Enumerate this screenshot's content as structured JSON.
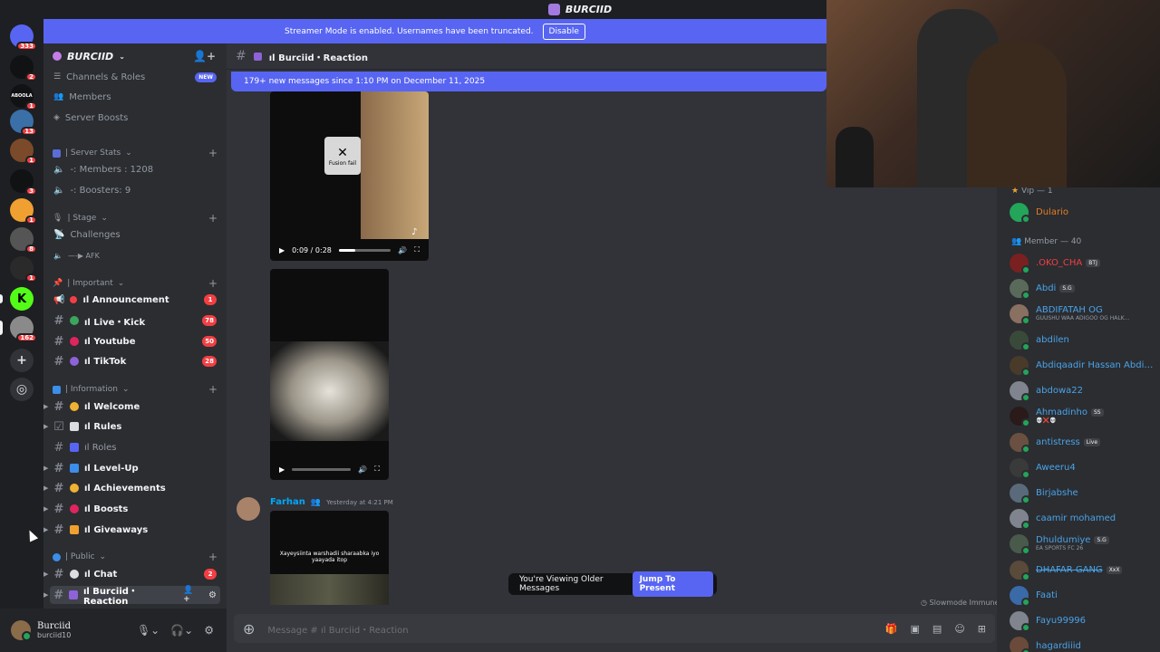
{
  "titlebar": {
    "title": "BURCIID"
  },
  "servers": [
    {
      "badge": "333",
      "color": "#5865f2",
      "label": ""
    },
    {
      "badge": "2",
      "color": "#111214",
      "label": ""
    },
    {
      "badge": "1",
      "color": "#111214",
      "label": "ABOOLA"
    },
    {
      "badge": "13",
      "color": "#3a6fa8",
      "label": ""
    },
    {
      "badge": "1",
      "color": "#7a4a2a",
      "label": ""
    },
    {
      "badge": "3",
      "color": "#111214",
      "label": ""
    },
    {
      "badge": "1",
      "color": "#f0a030",
      "label": ""
    },
    {
      "badge": "8",
      "color": "#555555",
      "label": ""
    },
    {
      "badge": "1",
      "color": "#2a2a2a",
      "label": ""
    },
    {
      "badge": "",
      "color": "#53fc18",
      "label": "K"
    },
    {
      "badge": "162",
      "color": "#8a8a8a",
      "label": ""
    }
  ],
  "banner": {
    "text": "Streamer Mode is enabled. Usernames have been truncated.",
    "button": "Disable"
  },
  "server_header": {
    "name": "BURCIID"
  },
  "sidebar": {
    "top_items": [
      {
        "label": "Channels & Roles",
        "badge": "NEW"
      },
      {
        "label": "Members"
      },
      {
        "label": "Server Boosts"
      }
    ],
    "server_stats": {
      "category": "| Server Stats",
      "items": [
        "-: Members : 1208",
        "-: Boosters: 9"
      ]
    },
    "stage": {
      "category": "| Stage",
      "items": [
        "Challenges",
        "—-▶ AFK"
      ]
    },
    "important": {
      "category": "| Important",
      "items": [
        {
          "label": "ıl Announcement",
          "count": "1"
        },
        {
          "label": "ıl Live・Kick",
          "count": "78"
        },
        {
          "label": "ıl Youtube",
          "count": "50"
        },
        {
          "label": "ıl TikTok",
          "count": "28"
        }
      ]
    },
    "information": {
      "category": "| Information",
      "items": [
        "ıl Welcome",
        "ıl Rules",
        "ıl Roles",
        "ıl Level-Up",
        "ıl Achievements",
        "ıl Boosts",
        "ıl Giveaways"
      ]
    },
    "public": {
      "category": "| Public",
      "items": [
        {
          "label": "ıl Chat",
          "count": "2"
        },
        {
          "label": "ıl Burciid・Reaction",
          "count": ""
        }
      ]
    }
  },
  "user": {
    "name": "Burciid",
    "tag": "burciid10"
  },
  "chat": {
    "channel": "ıl Burciid・Reaction",
    "new_messages": "179+ new messages since 1:10 PM on December 11, 2025",
    "video1": {
      "time": "0:09 / 0:28",
      "progress": 0.32,
      "overlay": "Fusion fail"
    },
    "video2": {
      "progress": 0.0
    },
    "author": {
      "name": "Farhan",
      "timestamp": "Yesterday at 4:21 PM"
    },
    "video3_caption": "Xayeysiinta warshadii sharaabka iyo yaayada itop",
    "older_notice": "You're Viewing Older Messages",
    "jump_button": "Jump To Present",
    "slowmode": "Slowmode Immune",
    "composer_placeholder": "Message #  ıl Burciid・Reaction"
  },
  "members": {
    "vip_category": "Vip — 1",
    "vip": [
      {
        "name": "Dulario",
        "color": "#e67e22",
        "avatar": "#23a55a"
      }
    ],
    "member_category": "Member — 40",
    "list": [
      {
        "name": ".OKO_CHA",
        "tag": "BTJ",
        "sub": "",
        "color": "#f23f43",
        "avatar": "#7a2020"
      },
      {
        "name": "Abdi",
        "tag": "S.G",
        "sub": "",
        "color": "#4aa3e8",
        "avatar": "#5a6a5a"
      },
      {
        "name": "ABDIFATAH OG",
        "tag": "",
        "sub": "GUUSHU WAA ADIGOO OG HALK...",
        "color": "#4aa3e8",
        "avatar": "#8a7060"
      },
      {
        "name": "abdilen",
        "tag": "",
        "sub": "",
        "color": "#4aa3e8",
        "avatar": "#3a4a3a"
      },
      {
        "name": "Abdiqaadir Hassan Abdiq...",
        "tag": "",
        "sub": "",
        "color": "#4aa3e8",
        "avatar": "#4a3a2a"
      },
      {
        "name": "abdowa22",
        "tag": "",
        "sub": "",
        "color": "#4aa3e8",
        "avatar": "#80848e"
      },
      {
        "name": "Ahmadinho",
        "tag": "SS",
        "sub": "💀❌💀",
        "color": "#4aa3e8",
        "avatar": "#2a1a1a"
      },
      {
        "name": "antistress",
        "tag": "Live",
        "sub": "",
        "color": "#4aa3e8",
        "avatar": "#6a5040"
      },
      {
        "name": "Aweeru4",
        "tag": "",
        "sub": "",
        "color": "#4aa3e8",
        "avatar": "#3a3a3a"
      },
      {
        "name": "Birjabshe",
        "tag": "",
        "sub": "",
        "color": "#4aa3e8",
        "avatar": "#5a6a7a"
      },
      {
        "name": "caamir mohamed",
        "tag": "",
        "sub": "",
        "color": "#4aa3e8",
        "avatar": "#80848e"
      },
      {
        "name": "Dhuldumiye",
        "tag": "S.G",
        "sub": "EA SPORTS FC 26",
        "color": "#4aa3e8",
        "avatar": "#4a5a4a"
      },
      {
        "name": "DHAFAR GANG",
        "tag": "XxX",
        "sub": "",
        "color": "#4aa3e8",
        "avatar": "#5a4a3a"
      },
      {
        "name": "Faati",
        "tag": "",
        "sub": "",
        "color": "#4aa3e8",
        "avatar": "#3a6aa8"
      },
      {
        "name": "Fayu99996",
        "tag": "",
        "sub": "",
        "color": "#4aa3e8",
        "avatar": "#80848e"
      },
      {
        "name": "hagardiiid",
        "tag": "",
        "sub": "",
        "color": "#4aa3e8",
        "avatar": "#6a4a3a"
      }
    ]
  }
}
